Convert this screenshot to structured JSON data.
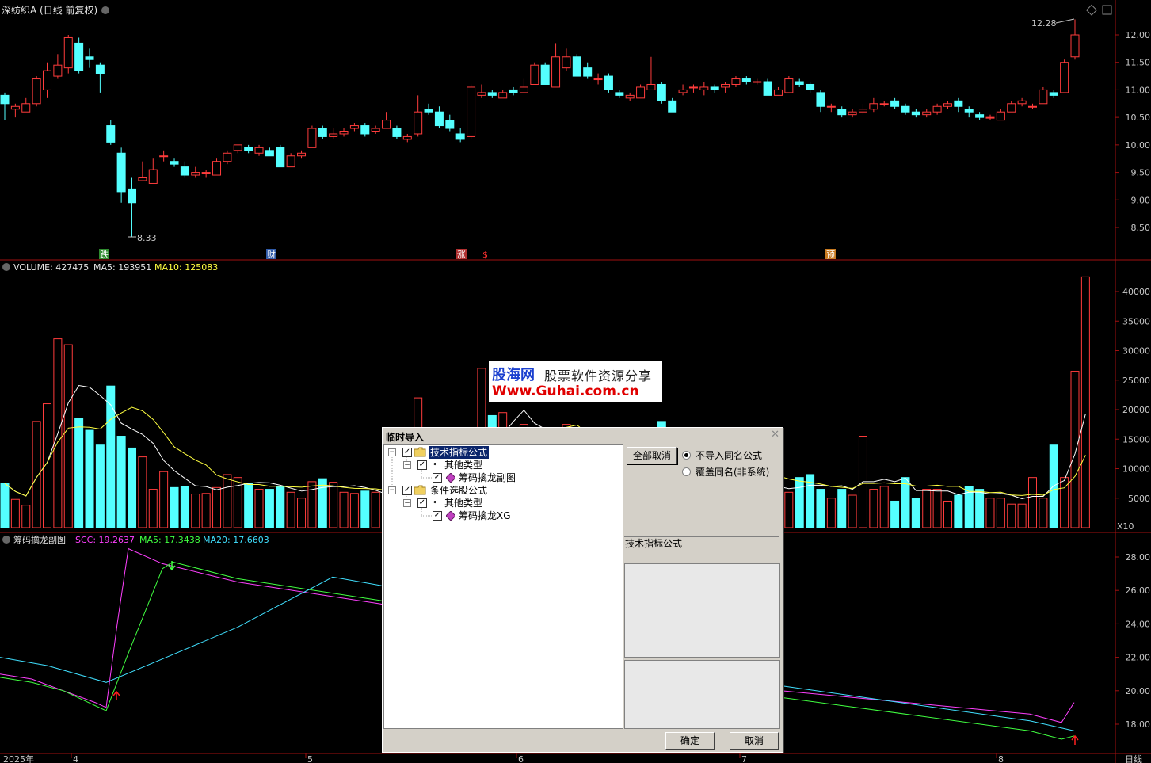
{
  "main_header": {
    "title": "深纺织A (日线 前复权)",
    "dropdown_icon": "chevron-down-icon"
  },
  "top_right_icons": [
    "diamond-icon",
    "window-icon"
  ],
  "price_axis": {
    "ticks": [
      "12.00",
      "11.50",
      "11.00",
      "10.50",
      "10.00",
      "9.50",
      "9.00",
      "8.50"
    ]
  },
  "price_annotations": {
    "high": "12.28",
    "low": "8.33"
  },
  "event_markers": [
    {
      "label": "跌",
      "color": "#2e8b2e"
    },
    {
      "label": "财",
      "color": "#2f5aa8"
    },
    {
      "label": "涨",
      "color": "#b03030"
    },
    {
      "label": "$",
      "color": "#ff3030"
    },
    {
      "label": "预",
      "color": "#c87a20"
    }
  ],
  "volume_header": {
    "name": "VOLUME: 427475",
    "ma5": "MA5: 193951",
    "ma10": "MA10: 125083"
  },
  "volume_axis": {
    "ticks": [
      "40000",
      "35000",
      "30000",
      "25000",
      "20000",
      "15000",
      "10000",
      "5000"
    ],
    "unit": "X10"
  },
  "indicator_header": {
    "name": "筹码擒龙副图",
    "scc": "SCC: 19.2637",
    "ma5": "MA5: 17.3438",
    "ma20": "MA20: 17.6603"
  },
  "indicator_axis": {
    "ticks": [
      "28.00",
      "26.00",
      "24.00",
      "22.00",
      "20.00",
      "18.00"
    ]
  },
  "date_axis": {
    "labels": [
      "2025年",
      "4",
      "5",
      "6",
      "7",
      "8"
    ],
    "period": "日线"
  },
  "colors": {
    "up": "#ff3c3c",
    "down": "#54ffff",
    "axis": "#a01010",
    "ma5_vol": "#ffffff",
    "ma10_vol": "#ffff40",
    "scc": "#ff40ff",
    "ma5_ind": "#40ff40",
    "ma20_ind": "#40e0ff"
  },
  "watermark": {
    "brand": "股海网",
    "slogan": "股票软件资源分享",
    "url": "Www.Guhai.com.cn"
  },
  "dialog": {
    "title": "临时导入",
    "close_icon": "close-icon",
    "tree": [
      {
        "label": "技术指标公式",
        "selected": true,
        "children": [
          {
            "label": "其他类型",
            "children": [
              {
                "label": "筹码擒龙副图"
              }
            ]
          }
        ]
      },
      {
        "label": "条件选股公式",
        "selected": false,
        "children": [
          {
            "label": "其他类型",
            "children": [
              {
                "label": "筹码擒龙XG"
              }
            ]
          }
        ]
      }
    ],
    "cancel_all_label": "全部取消",
    "radio_options": [
      {
        "label": "不导入同名公式",
        "checked": true
      },
      {
        "label": "覆盖同名(非系统)",
        "checked": false
      }
    ],
    "info_label": "技术指标公式",
    "ok_label": "确定",
    "cancel_label": "取消"
  }
}
